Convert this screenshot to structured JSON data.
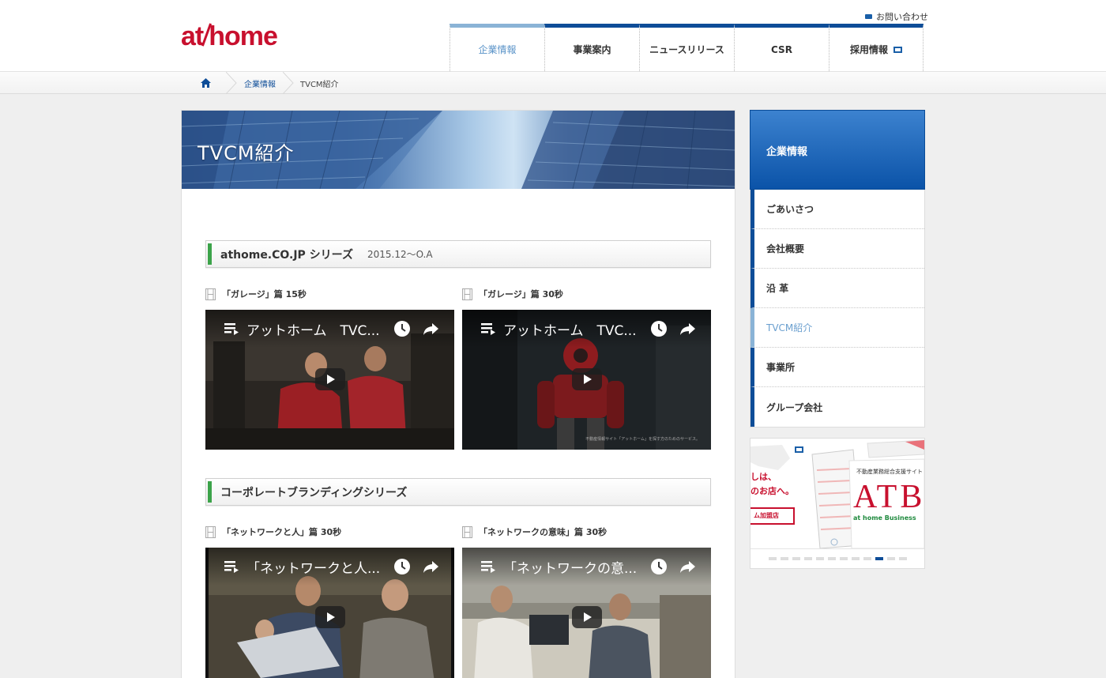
{
  "header": {
    "logo_text_1": "at",
    "logo_text_2": "home",
    "contact_label": "お問い合わせ",
    "nav": [
      {
        "label": "企業情報"
      },
      {
        "label": "事業案内"
      },
      {
        "label": "ニュースリリース"
      },
      {
        "label": "CSR"
      },
      {
        "label": "採用情報"
      }
    ]
  },
  "breadcrumb": {
    "items": [
      {
        "label": "企業情報"
      },
      {
        "label": "TVCM紹介"
      }
    ]
  },
  "main": {
    "page_title": "TVCM紹介",
    "sections": [
      {
        "title": "athome.CO.JP シリーズ",
        "date": "2015.12～O.A",
        "videos": [
          {
            "label": "「ガレージ」篇 15秒",
            "title": "アットホーム　TVC..."
          },
          {
            "label": "「ガレージ」篇 30秒",
            "title": "アットホーム　TVC...",
            "caption": "不動産情報サイト「アットホーム」を探す方のためのサービス。"
          }
        ]
      },
      {
        "title": "コーポレートブランディングシリーズ",
        "date": "",
        "videos": [
          {
            "label": "「ネットワークと人」篇 30秒",
            "title": "「ネットワークと人..."
          },
          {
            "label": "「ネットワークの意味」篇 30秒",
            "title": "「ネットワークの意..."
          }
        ]
      }
    ]
  },
  "side": {
    "heading": "企業情報",
    "items": [
      {
        "label": "ごあいさつ"
      },
      {
        "label": "会社概要"
      },
      {
        "label": "沿 革"
      },
      {
        "label": "TVCM紹介"
      },
      {
        "label": "事業所"
      },
      {
        "label": "グループ会社"
      }
    ]
  },
  "banner": {
    "text1": "しは、",
    "text2": "のお店へ。",
    "button": "ム加盟店",
    "sub": "不動産業務総合支援サイト",
    "logo": "ATB",
    "logo_sub": "at home Business",
    "dot_count": 12,
    "active_dot": 9
  },
  "colors": {
    "brand_red": "#c8102e",
    "nav_blue": "#0e4d98",
    "active_light_blue": "#8ab3d6",
    "section_green": "#3ca34a"
  }
}
